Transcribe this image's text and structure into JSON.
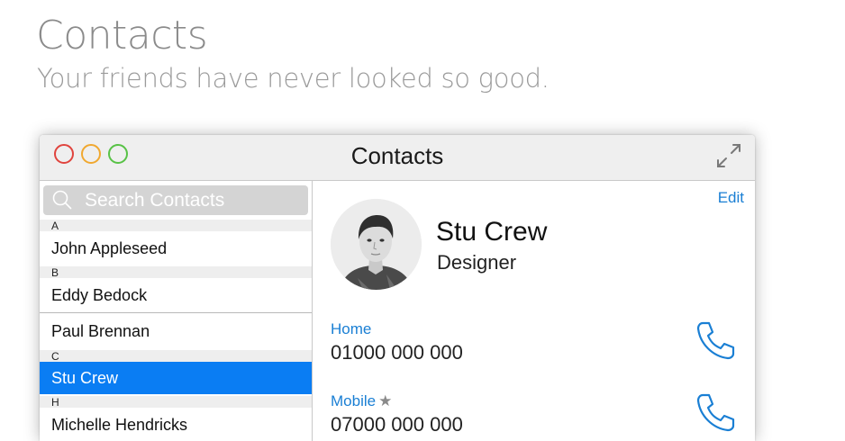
{
  "hero": {
    "title": "Contacts",
    "subtitle": "Your friends have never looked so good."
  },
  "window": {
    "title": "Contacts",
    "controls": [
      "close",
      "minimize",
      "maximize"
    ],
    "expand_icon": "expand-arrows-icon"
  },
  "sidebar": {
    "search_placeholder": "Search Contacts",
    "sections": [
      {
        "letter": "A",
        "contacts": [
          "John Appleseed"
        ]
      },
      {
        "letter": "B",
        "contacts": [
          "Eddy Bedock",
          "Paul Brennan"
        ]
      },
      {
        "letter": "C",
        "contacts": [
          "Stu Crew"
        ]
      },
      {
        "letter": "H",
        "contacts": [
          "Michelle Hendricks"
        ]
      }
    ],
    "selected": "Stu Crew"
  },
  "detail": {
    "edit_label": "Edit",
    "name": "Stu Crew",
    "role": "Designer",
    "fields": [
      {
        "label": "Home",
        "value": "01000 000 000",
        "favorite": false
      },
      {
        "label": "Mobile",
        "value": "07000 000 000",
        "favorite": true
      }
    ]
  },
  "colors": {
    "accent": "#0a7df3",
    "link": "#1a7fd4",
    "close": "#e0443e",
    "minimize": "#f0a830",
    "maximize": "#58c246"
  }
}
